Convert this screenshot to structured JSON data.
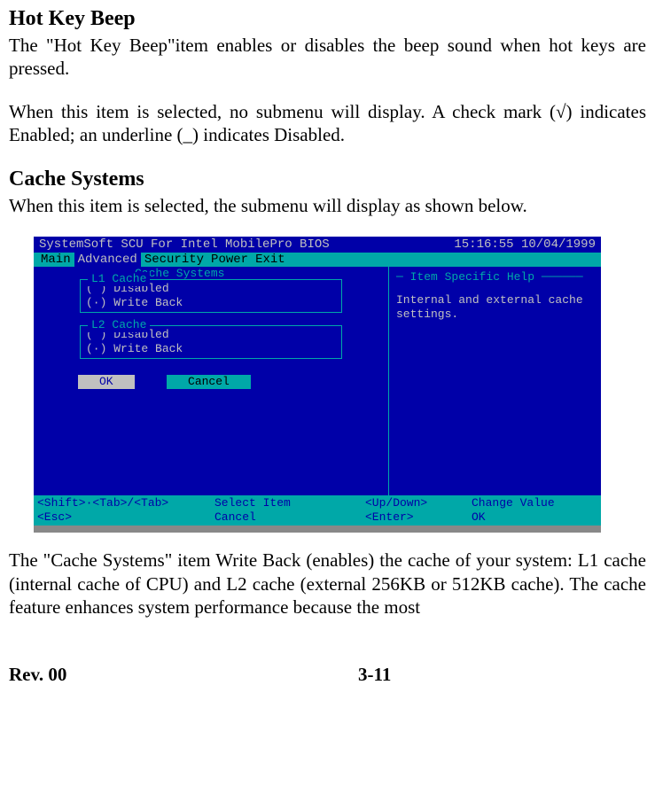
{
  "section1": {
    "heading": "Hot Key Beep",
    "p1": "The \"Hot Key Beep\"item enables or disables the beep sound when hot keys are pressed.",
    "p2": "When this item is selected, no submenu will display. A check mark (√) indicates Enabled; an underline (_) indicates Disabled."
  },
  "section2": {
    "heading": "Cache Systems",
    "p1": "When this item is selected, the submenu will display as shown below.",
    "p2": "The \"Cache Systems\" item Write Back (enables) the cache of your system: L1 cache (internal cache of CPU) and L2 cache (external 256KB or 512KB cache). The cache feature enhances system performance because the most"
  },
  "bios": {
    "title_left": "SystemSoft SCU For Intel MobilePro BIOS",
    "title_right": "15:16:55  10/04/1999",
    "menu": {
      "main": "Main",
      "advanced": "Advanced",
      "security": "Security",
      "power": "Power",
      "exit": "Exit"
    },
    "panel_title": "Cache Systems",
    "l1": {
      "title": "L1 Cache",
      "opt1": "( ) Disabled",
      "opt2": "(·) Write Back"
    },
    "l2": {
      "title": "L2 Cache",
      "opt1": "( ) Disabled",
      "opt2": "(·) Write Back"
    },
    "ok": "OK",
    "cancel": "Cancel",
    "help_title": "Item Specific Help",
    "help_body": "Internal and external cache settings.",
    "footer": {
      "c1a": "<Shift>·<Tab>/<Tab>",
      "c1b": "<Esc>",
      "c2a": "Select Item",
      "c2b": "Cancel",
      "c3a": "<Up/Down>",
      "c3b": "<Enter>",
      "c4a": "Change Value",
      "c4b": "OK"
    }
  },
  "footer": {
    "rev": "Rev. 00",
    "page": "3-11"
  }
}
